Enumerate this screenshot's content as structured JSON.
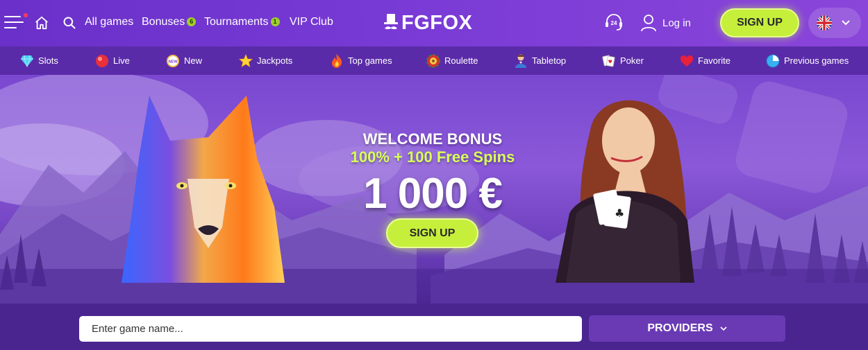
{
  "header": {
    "nav": [
      {
        "label": "All games"
      },
      {
        "label": "Bonuses",
        "badge": "6"
      },
      {
        "label": "Tournaments",
        "badge": "1"
      },
      {
        "label": "VIP Club"
      }
    ],
    "logo_text": "FGFOX",
    "support_label": "24",
    "login_label": "Log in",
    "signup_label": "SIGN UP",
    "language_flag": "uk-flag"
  },
  "categories": [
    {
      "label": "Slots",
      "icon": "diamond-icon"
    },
    {
      "label": "Live",
      "icon": "live-dot-icon"
    },
    {
      "label": "New",
      "icon": "new-badge-icon"
    },
    {
      "label": "Jackpots",
      "icon": "star-icon"
    },
    {
      "label": "Top games",
      "icon": "fire-icon"
    },
    {
      "label": "Roulette",
      "icon": "roulette-icon"
    },
    {
      "label": "Tabletop",
      "icon": "dealer-icon"
    },
    {
      "label": "Poker",
      "icon": "cards-icon"
    },
    {
      "label": "Favorite",
      "icon": "heart-icon"
    },
    {
      "label": "Previous games",
      "icon": "clock-icon"
    }
  ],
  "hero": {
    "title": "WELCOME BONUS",
    "subtitle": "100% + 100 Free Spins",
    "amount": "1 000 €",
    "cta_label": "SIGN UP"
  },
  "search": {
    "placeholder": "Enter game name..."
  },
  "providers_label": "PROVIDERS",
  "colors": {
    "accent_green": "#c6ef3c",
    "header_purple": "#6a30c9",
    "category_purple": "#5a2ba8",
    "page_purple": "#4a2590",
    "badge_green": "#9fd02a"
  }
}
